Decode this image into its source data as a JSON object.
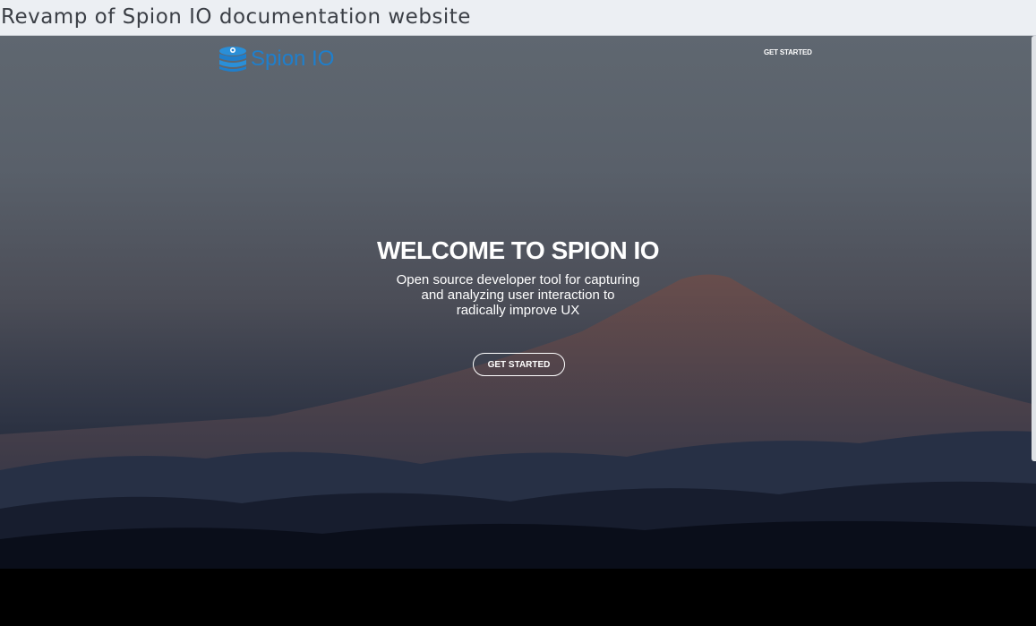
{
  "window": {
    "title": "Revamp of Spion IO documentation website"
  },
  "nav": {
    "logo_text": "Spion IO",
    "cta_label": "GET STARTED"
  },
  "hero": {
    "headline": "WELCOME TO SPION IO",
    "subtitle_lines": [
      "Open source developer tool for capturing",
      "and analyzing user interaction to",
      "radically improve UX"
    ],
    "cta_label": "GET STARTED"
  },
  "colors": {
    "brand_blue": "#1f7fcc",
    "titlebar_bg": "#eceff3",
    "text_white": "#ffffff"
  },
  "icons": {
    "logo": "database-icon"
  }
}
